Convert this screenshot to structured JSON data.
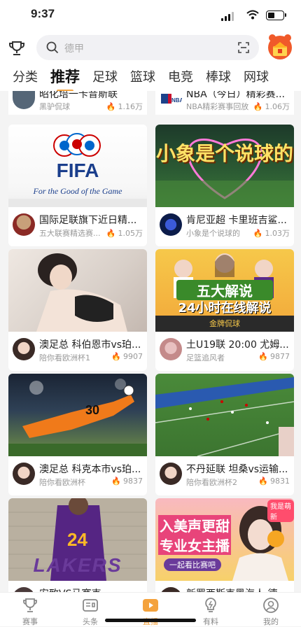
{
  "status": {
    "time": "9:37"
  },
  "search": {
    "placeholder": "德甲"
  },
  "tabs": [
    {
      "label": "分类"
    },
    {
      "label": "推荐"
    },
    {
      "label": "足球"
    },
    {
      "label": "篮球"
    },
    {
      "label": "电竞"
    },
    {
      "label": "棒球"
    },
    {
      "label": "网球"
    }
  ],
  "top_partial": [
    {
      "title": "昭化培一卡音斯联",
      "channel": "黑驴侃球",
      "count": "1.16万"
    },
    {
      "title": "NBA（今日）精彩赛...",
      "channel": "NBA精彩赛事回放",
      "count": "1.06万"
    }
  ],
  "cards": [
    {
      "thumb_text": "FIFA",
      "thumb_sub": "For the Good of the Game",
      "title": "国际足联旗下近日精...",
      "channel": "五大联赛精选赛...",
      "count": "1.05万"
    },
    {
      "thumb_text": "小象是个说球的",
      "title": "肯尼亚超 卡里班吉鲨...",
      "channel": "小象是个说球的",
      "count": "1.03万"
    },
    {
      "title": "澳足总  科伯恩市vs珀...",
      "channel": "陪你看欧洲杯1",
      "count": "9907"
    },
    {
      "thumb_text": "五大解说",
      "thumb_sub": "24小时在线解说",
      "thumb_tag": "金牌侃球",
      "title": "土U19联  20:00  尤姆...",
      "channel": "足篮追风者",
      "count": "9877"
    },
    {
      "thumb_text": "30",
      "title": "澳足总  科克本市vs珀...",
      "channel": "陪你看欧洲杯",
      "count": "9837"
    },
    {
      "title": "不丹延联 坦桑vs运输...",
      "channel": "陪你看欧洲杯2",
      "count": "9831"
    }
  ],
  "bottom_partial": [
    {
      "thumb_text": "24",
      "thumb_sub": "LAKERS",
      "title": "安致VS马赛克"
    },
    {
      "thumb_text": "入美声更甜",
      "thumb_sub": "专业女主播",
      "thumb_tag": "一起看比赛吧",
      "thumb_badge": "我是萌新",
      "title": "新罗西斯克黑海人  德"
    }
  ],
  "bottom_nav": [
    {
      "label": "赛事"
    },
    {
      "label": "头条"
    },
    {
      "label": "直播"
    },
    {
      "label": "有料"
    },
    {
      "label": "我的"
    }
  ]
}
